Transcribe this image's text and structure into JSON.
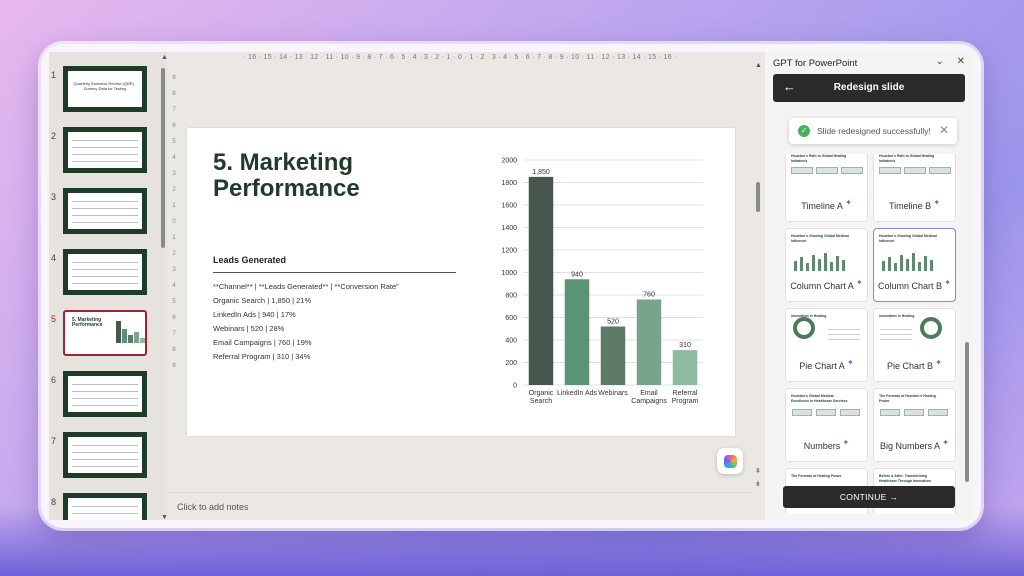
{
  "thumbnails": [
    {
      "number": "1",
      "title": "Quarterly Business Review (QBR) - Dummy Data for Testing"
    },
    {
      "number": "2",
      "title": ""
    },
    {
      "number": "3",
      "title": ""
    },
    {
      "number": "4",
      "title": ""
    },
    {
      "number": "5",
      "title": "5. Marketing Performance",
      "active": true
    },
    {
      "number": "6",
      "title": ""
    },
    {
      "number": "7",
      "title": ""
    },
    {
      "number": "8",
      "title": ""
    }
  ],
  "ruler": {
    "top": "· 16 · 15 · 14 · 13 · 12 · 11 · 10 · 9 · 8 · 7 · 6 · 5 · 4 · 3 · 2 · 1 · 0 · 1 · 2 · 3 · 4 · 5 · 6 · 7 · 8 · 9 · 10 · 11 · 12 · 13 · 14 · 15 · 16 ·",
    "left": [
      "9",
      "8",
      "7",
      "6",
      "5",
      "4",
      "3",
      "2",
      "1",
      "0",
      "1",
      "2",
      "3",
      "4",
      "5",
      "6",
      "7",
      "8",
      "9"
    ]
  },
  "slide": {
    "title": "5. Marketing Performance",
    "leads_heading": "Leads Generated",
    "lines": [
      "**Channel** | **Leads Generated** | **Conversion Rate\"",
      "Organic Search | 1,850 | 21%",
      "LinkedIn Ads | 940 | 17%",
      "Webinars | 520 | 28%",
      "Email Campaigns | 760 | 19%",
      "Referral Program | 310 | 34%"
    ]
  },
  "chart_data": {
    "type": "bar",
    "categories": [
      "Organic Search",
      "LinkedIn Ads",
      "Webinars",
      "Email Campaigns",
      "Referral Program"
    ],
    "category_lines": [
      [
        "Organic",
        "Search"
      ],
      [
        "LinkedIn Ads"
      ],
      [
        "Webinars"
      ],
      [
        "Email",
        "Campaigns"
      ],
      [
        "Referral",
        "Program"
      ]
    ],
    "values": [
      1850,
      940,
      520,
      760,
      310
    ],
    "value_labels": [
      "1,850",
      "940",
      "520",
      "760",
      "310"
    ],
    "title": "",
    "xlabel": "",
    "ylabel": "",
    "ylim": [
      0,
      2000
    ],
    "yticks": [
      0,
      200,
      400,
      600,
      800,
      1000,
      1200,
      1400,
      1600,
      1800,
      2000
    ],
    "grid": true,
    "legend": "none",
    "bar_colors": [
      "#48574d",
      "#5a9375",
      "#5e7a68",
      "#78a48d",
      "#8fba9f"
    ]
  },
  "notes": {
    "placeholder": "Click to add notes"
  },
  "panel": {
    "header": "GPT for PowerPoint",
    "redesign_title": "Redesign slide",
    "toast": "Slide redesigned successfully!",
    "cards": [
      {
        "label": "Timeline A",
        "mini_title": "Houston's Path to Global Healing Initiatives"
      },
      {
        "label": "Timeline B",
        "mini_title": "Houston's Path to Global Healing Initiatives"
      },
      {
        "label": "Column Chart A",
        "mini_title": "Houston's Growing Global Medical Influence"
      },
      {
        "label": "Column Chart B",
        "mini_title": "Houston's Growing Global Medical Influence",
        "selected": true
      },
      {
        "label": "Pie Chart A",
        "mini_title": "Innovation in Healing"
      },
      {
        "label": "Pie Chart B",
        "mini_title": "Innovation in Healing"
      },
      {
        "label": "Numbers",
        "mini_title": "Houston's Global Medical Excellence in Healthcare Services"
      },
      {
        "label": "Big Numbers A",
        "mini_title": "The Formula of Houston's Healing Power"
      },
      {
        "label": "",
        "mini_title": "The Formula of Healing Power"
      },
      {
        "label": "",
        "mini_title": "Before & After: Transforming Healthcare Through Innovation"
      }
    ],
    "continue_label": "CONTINUE"
  },
  "colors": {
    "brand_dark_green": "#1f3b2a",
    "accent_purple": "#6b5ce7",
    "active_red": "#9b2430",
    "success_green": "#46b05c"
  }
}
